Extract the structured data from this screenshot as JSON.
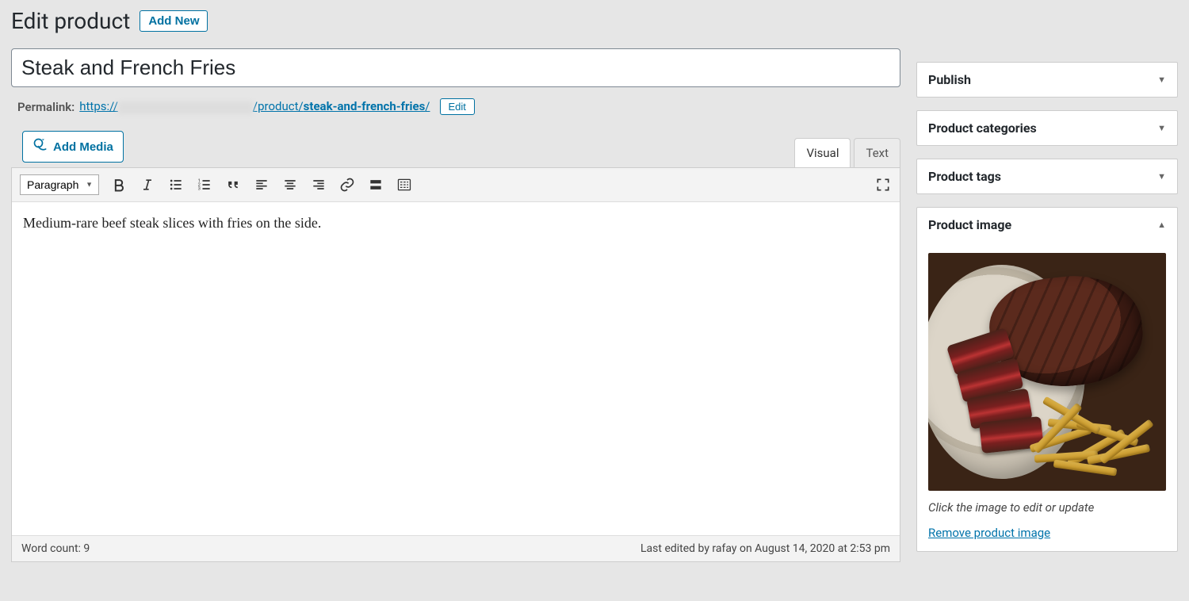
{
  "heading": "Edit product",
  "add_new": "Add New",
  "title_value": "Steak and French Fries",
  "permalink": {
    "label": "Permalink:",
    "prefix": "https://",
    "mid": "/product/",
    "slug": "steak-and-french-fries",
    "trail": "/",
    "edit": "Edit"
  },
  "add_media": "Add Media",
  "tabs": {
    "visual": "Visual",
    "text": "Text"
  },
  "format_option": "Paragraph",
  "content": "Medium-rare beef steak slices with fries on the side.",
  "word_count_label": "Word count: ",
  "word_count": "9",
  "last_edited": "Last edited by rafay on August 14, 2020 at 2:53 pm",
  "side": {
    "publish": "Publish",
    "categories": "Product categories",
    "tags": "Product tags",
    "image_title": "Product image",
    "image_hint": "Click the image to edit or update",
    "remove": "Remove product image"
  }
}
